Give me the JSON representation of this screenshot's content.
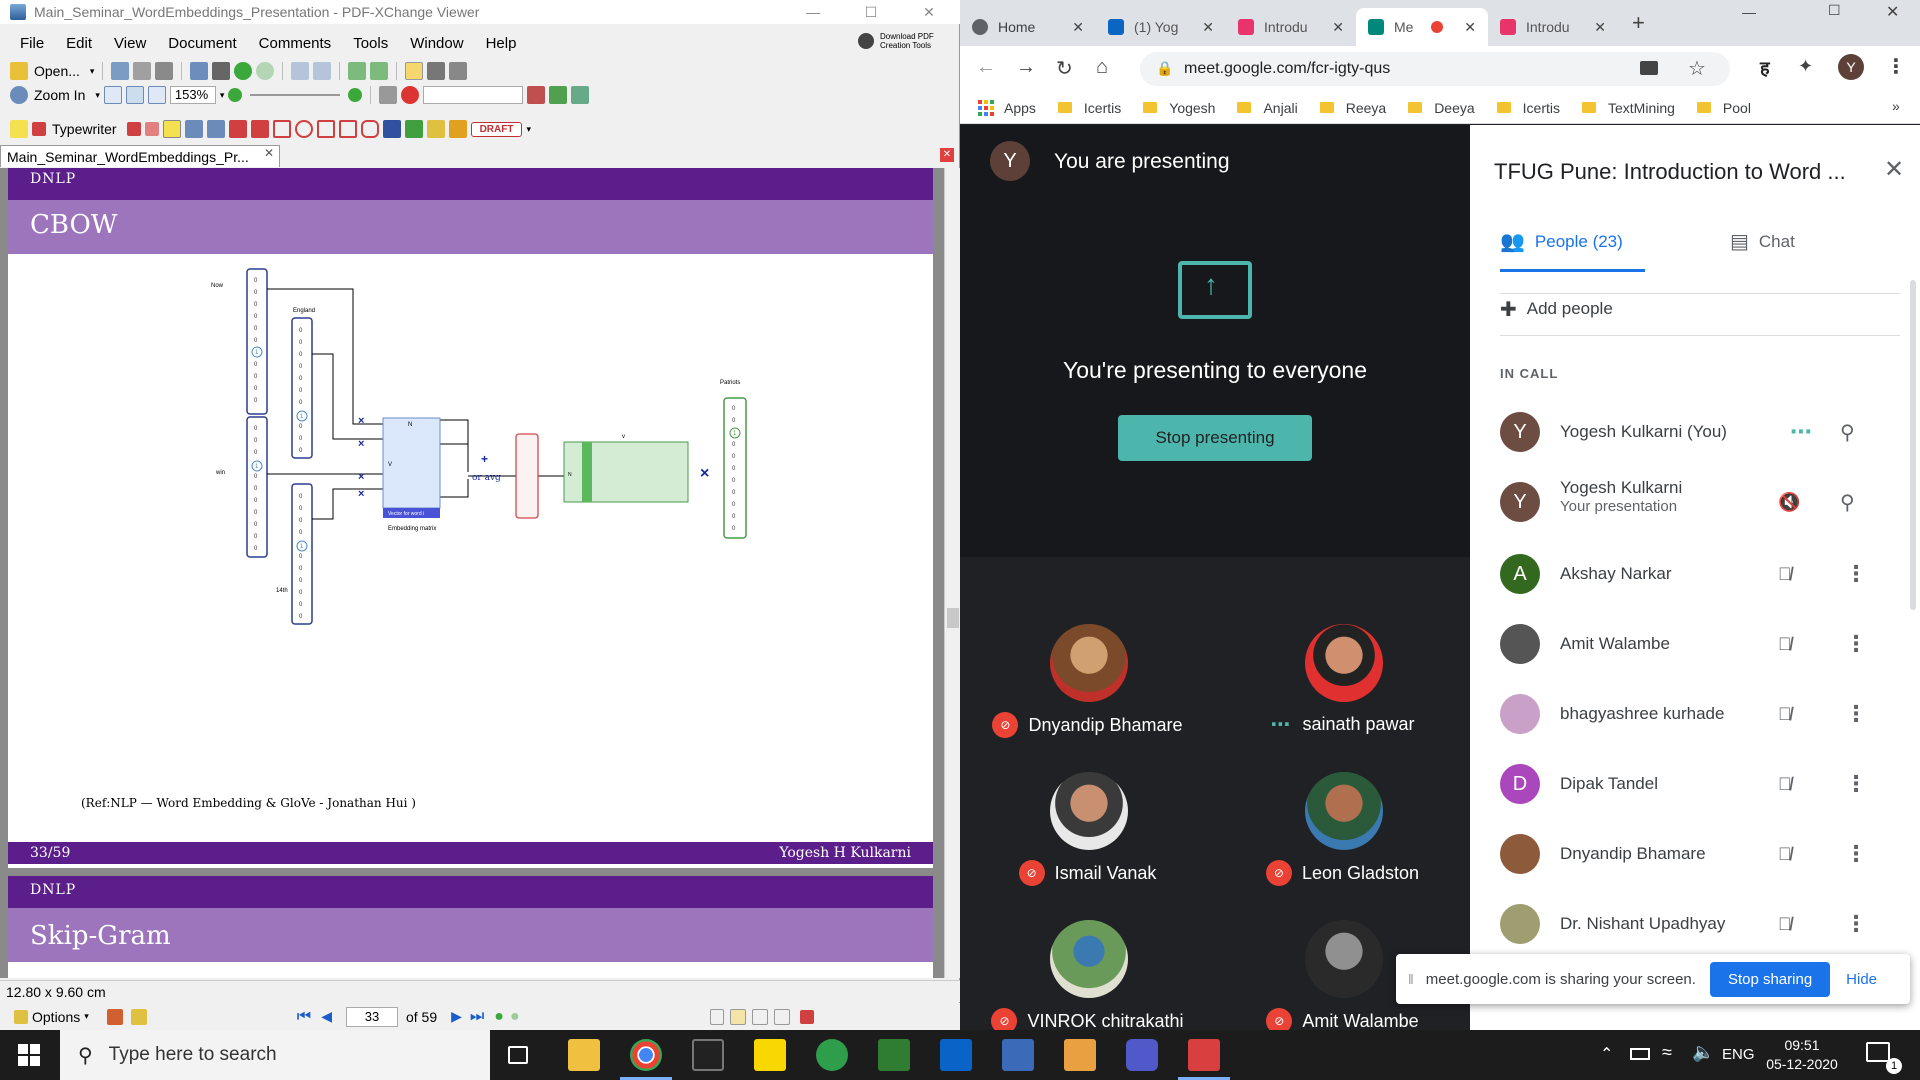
{
  "pdf": {
    "window_title": "Main_Seminar_WordEmbeddings_Presentation - PDF-XChange Viewer",
    "download_btn": "Download PDF Creation Tools",
    "menu": [
      "File",
      "Edit",
      "View",
      "Document",
      "Comments",
      "Tools",
      "Window",
      "Help"
    ],
    "toolbar1": {
      "open": "Open..."
    },
    "toolbar2": {
      "zoom_in": "Zoom In",
      "zoom_value": "153%"
    },
    "toolbar3": {
      "typewriter": "Typewriter",
      "draft": "DRAFT"
    },
    "tab_title": "Main_Seminar_WordEmbeddings_Pr...",
    "page1": {
      "header_small": "DNLP",
      "title": "CBOW",
      "diagram": {
        "label_now": "Now",
        "label_england": "England",
        "label_win": "win",
        "label_14th": "14th",
        "label_patriots": "Patriots",
        "label_N": "N",
        "label_V": "V",
        "label_V2": "v",
        "label_vector_word": "Vector for word i",
        "label_embedding": "Embedding matrix",
        "label_or_avg": "or avg",
        "label_plus": "+",
        "label_x": "×"
      },
      "reference": "(Ref:NLP — Word Embedding & GloVe - Jonathan Hui )",
      "page_num": "33/59",
      "author": "Yogesh H Kulkarni"
    },
    "page2": {
      "header_small": "DNLP",
      "title": "Skip-Gram"
    },
    "status_size": "12.80 x 9.60 cm",
    "nav": {
      "options": "Options",
      "current_page": "33",
      "of_pages": "of 59"
    }
  },
  "chrome": {
    "tabs": [
      {
        "label": "Home",
        "color": "#5f6368"
      },
      {
        "label": "(1) Yog",
        "color": "#0a66c2"
      },
      {
        "label": "Introdu",
        "color": "#e8336b"
      },
      {
        "label": "Me",
        "color": "#00897b"
      },
      {
        "label": "Introdu",
        "color": "#e8336b"
      }
    ],
    "url": "meet.google.com/fcr-igty-qus",
    "bookmarks": [
      "Apps",
      "Icertis",
      "Yogesh",
      "Anjali",
      "Reeya",
      "Deeya",
      "Icertis",
      "TextMining",
      "Pool"
    ],
    "profile_initial": "Y"
  },
  "meet": {
    "presenting_banner": "You are presenting",
    "presenter_initial": "Y",
    "presenting_to": "You're presenting to everyone",
    "stop_presenting": "Stop presenting",
    "tiles": [
      {
        "name": "Dnyandip Bhamare",
        "muted": true
      },
      {
        "name": "sainath pawar",
        "muted": false
      },
      {
        "name": "Ismail Vanak",
        "muted": true
      },
      {
        "name": "Leon Gladston",
        "muted": true
      },
      {
        "name": "VINROK chitrakathi",
        "muted": true
      },
      {
        "name": "Amit Walambe",
        "muted": true
      }
    ],
    "panel_title": "TFUG Pune: Introduction to Word ...",
    "tab_people": "People (23)",
    "tab_chat": "Chat",
    "add_people": "Add people",
    "in_call": "IN CALL",
    "participants": [
      {
        "name": "Yogesh Kulkarni (You)",
        "initial": "Y",
        "color": "#6d4c41",
        "sub": ""
      },
      {
        "name": "Yogesh Kulkarni",
        "initial": "Y",
        "color": "#6d4c41",
        "sub": "Your presentation"
      },
      {
        "name": "Akshay Narkar",
        "initial": "A",
        "color": "#33691e",
        "sub": ""
      },
      {
        "name": "Amit Walambe",
        "initial": "",
        "color": "#555555",
        "sub": ""
      },
      {
        "name": "bhagyashree kurhade",
        "initial": "",
        "color": "#c8a0c8",
        "sub": ""
      },
      {
        "name": "Dipak Tandel",
        "initial": "D",
        "color": "#ab47bc",
        "sub": ""
      },
      {
        "name": "Dnyandip Bhamare",
        "initial": "",
        "color": "#8d5a3b",
        "sub": ""
      },
      {
        "name": "Dr. Nishant Upadhyay",
        "initial": "",
        "color": "#9e9e70",
        "sub": ""
      }
    ],
    "share_notice": "meet.google.com is sharing your screen.",
    "stop_sharing": "Stop sharing",
    "hide": "Hide"
  },
  "taskbar": {
    "search_placeholder": "Type here to search",
    "lang": "ENG",
    "time": "09:51",
    "date": "05-12-2020",
    "notif_count": "1"
  }
}
